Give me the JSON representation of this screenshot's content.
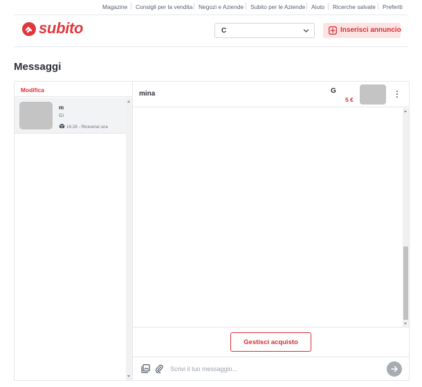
{
  "top_links": [
    "Magazine",
    "Consigli per la vendita",
    "Negozi e Aziende",
    "Subito per le Aziende",
    "Aiuto",
    "Ricerche salvate",
    "Preferiti"
  ],
  "header": {
    "logo_text": "subito",
    "category_select": {
      "value": "C"
    },
    "insert_button_label": "Inserisci annuncio"
  },
  "page_title": "Messaggi",
  "conversation_list": {
    "edit_label": "Modifica",
    "items": [
      {
        "name": "m",
        "subtitle": "Gi",
        "meta": "16:28 - Riceverai una"
      }
    ]
  },
  "chat": {
    "title": "mina",
    "ad_title": "G",
    "ad_price": "5 €",
    "manage_button_label": "Gestisci acquisto",
    "composer_placeholder": "Scrivi il tuo messaggio..."
  },
  "colors": {
    "brand_red": "#d62e33",
    "insert_bg": "#fde4e4",
    "selected_row_bg": "#f2f3f5",
    "send_button": "#a7acb3"
  }
}
